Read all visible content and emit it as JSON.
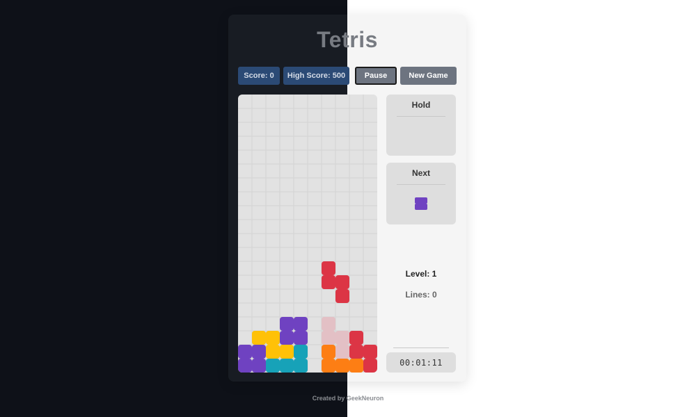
{
  "title": "Tetris",
  "score_label": "Score: 0",
  "high_score_label": "High Score: 500",
  "pause_label": "Pause",
  "new_game_label": "New Game",
  "hold_label": "Hold",
  "next_label": "Next",
  "level_label": "Level: 1",
  "lines_label": "Lines: 0",
  "timer": "00:01:11",
  "credit": "Created by GeekNeuron",
  "colors": {
    "I": "#17a2b8",
    "O": "#ffc107",
    "T": "#6f42c1",
    "S": "#dc3545",
    "L": "#fd7e14",
    "ghost": "#e3c0c5"
  },
  "board": {
    "columns": 10,
    "rows": 20,
    "locked_cells": [
      {
        "c": 3,
        "r": 16,
        "t": "T"
      },
      {
        "c": 4,
        "r": 16,
        "t": "T"
      },
      {
        "c": 3,
        "r": 17,
        "t": "T"
      },
      {
        "c": 4,
        "r": 17,
        "t": "T"
      },
      {
        "c": 1,
        "r": 17,
        "t": "O"
      },
      {
        "c": 2,
        "r": 17,
        "t": "O"
      },
      {
        "c": 2,
        "r": 18,
        "t": "O"
      },
      {
        "c": 3,
        "r": 18,
        "t": "O"
      },
      {
        "c": 0,
        "r": 18,
        "t": "T"
      },
      {
        "c": 1,
        "r": 18,
        "t": "T"
      },
      {
        "c": 0,
        "r": 19,
        "t": "T"
      },
      {
        "c": 1,
        "r": 19,
        "t": "T"
      },
      {
        "c": 4,
        "r": 18,
        "t": "I"
      },
      {
        "c": 2,
        "r": 19,
        "t": "I"
      },
      {
        "c": 3,
        "r": 19,
        "t": "I"
      },
      {
        "c": 4,
        "r": 19,
        "t": "I"
      },
      {
        "c": 6,
        "r": 18,
        "t": "L"
      },
      {
        "c": 6,
        "r": 19,
        "t": "L"
      },
      {
        "c": 7,
        "r": 19,
        "t": "L"
      },
      {
        "c": 8,
        "r": 19,
        "t": "L"
      },
      {
        "c": 8,
        "r": 17,
        "t": "S"
      },
      {
        "c": 8,
        "r": 18,
        "t": "S"
      },
      {
        "c": 9,
        "r": 18,
        "t": "S"
      },
      {
        "c": 9,
        "r": 19,
        "t": "S"
      }
    ],
    "active_piece": [
      {
        "c": 6,
        "r": 12,
        "t": "S"
      },
      {
        "c": 6,
        "r": 13,
        "t": "S"
      },
      {
        "c": 7,
        "r": 13,
        "t": "S"
      },
      {
        "c": 7,
        "r": 14,
        "t": "S"
      }
    ],
    "ghost_piece": [
      {
        "c": 6,
        "r": 16
      },
      {
        "c": 6,
        "r": 17
      },
      {
        "c": 7,
        "r": 17
      },
      {
        "c": 7,
        "r": 18
      }
    ]
  },
  "next_piece": {
    "type": "T",
    "cells": [
      {
        "c": 0,
        "r": 0
      },
      {
        "c": 0,
        "r": 1
      }
    ]
  }
}
